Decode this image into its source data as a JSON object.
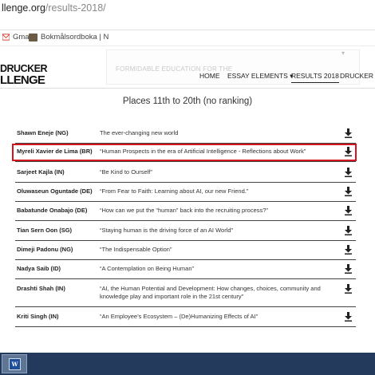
{
  "browser": {
    "url_host": "llenge.org",
    "url_path": "/results-2018/",
    "bookmarks": [
      {
        "label": "Gmail",
        "icon": "gmail-icon"
      },
      {
        "label": "Bokmålsordboka | N",
        "icon": "book-icon"
      }
    ]
  },
  "site": {
    "logo_line1": "DRUCKER",
    "logo_line2": "LLENGE",
    "ghost_text": "FORMIDABLE EDUCATION FOR THE",
    "nav": [
      "HOME",
      "ESSAY ELEMENTS",
      "RESULTS 2018",
      "DRUCKER FO"
    ],
    "nav_active": "RESULTS 2018"
  },
  "heading": "Places 11th to 20th (no ranking)",
  "rows": [
    {
      "name": "Shawn Eneje (NG)",
      "title": "The ever-changing new world"
    },
    {
      "name": "Myreli Xavier de Lima (BR)",
      "title": "“Human Prospects in the era of Artificial Intelligence - Reflections about Work”"
    },
    {
      "name": "Sarjeet Kajla (IN)",
      "title": "“Be Kind to Ourself”"
    },
    {
      "name": "Oluwaseun Oguntade (DE)",
      "title": "“From Fear to Faith: Learning about AI, our new Friend.”"
    },
    {
      "name": "Babatunde Onabajo (DE)",
      "title": "“How can we put the “human” back into the recruiting process?”"
    },
    {
      "name": "Tian Sern Oon (SG)",
      "title": "“Staying human is the driving force of an AI World”"
    },
    {
      "name": "Dimeji Padonu (NG)",
      "title": "“The Indispensable Option”"
    },
    {
      "name": "Nadya Saib (ID)",
      "title": "“A Contemplation on Being Human”"
    },
    {
      "name": "Drashti Shah (IN)",
      "title": "“AI, the Human Potential and Development: How changes, choices, community and knowledge play and important role in the 21st century”"
    },
    {
      "name": "Kriti Singh (IN)",
      "title": "“An Employee’s Ecosystem – (De)Humanizing Effects of AI”"
    }
  ],
  "highlighted_row": 1,
  "colors": {
    "highlight": "#d4141f",
    "taskbar": "#233a5c"
  },
  "taskbar": {
    "app_icon": "word-icon",
    "app_glyph": "W"
  }
}
